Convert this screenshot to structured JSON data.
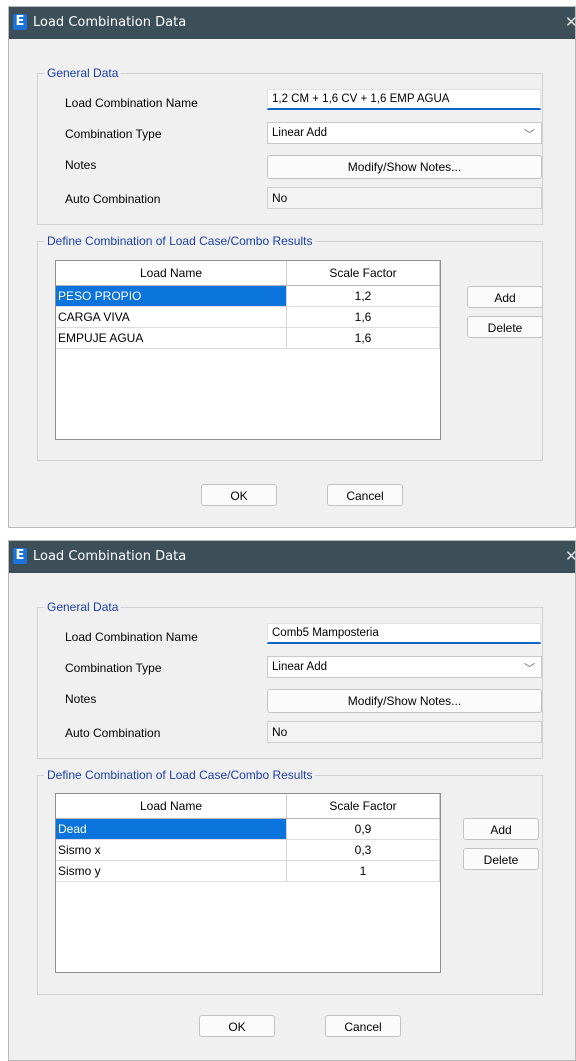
{
  "dialogs": [
    {
      "title": "Load Combination Data",
      "logo": "E",
      "general_group": "General Data",
      "name_label": "Load Combination Name",
      "name_value": "1,2 CM + 1,6 CV + 1,6 EMP AGUA",
      "type_label": "Combination Type",
      "type_value": "Linear Add",
      "notes_label": "Notes",
      "notes_button": "Modify/Show Notes...",
      "auto_label": "Auto Combination",
      "auto_value": "No",
      "define_group": "Define Combination of Load Case/Combo Results",
      "columns": [
        "Load Name",
        "Scale Factor"
      ],
      "rows": [
        {
          "name": "PESO PROPIO",
          "factor": "1,2",
          "selected": true
        },
        {
          "name": "CARGA VIVA",
          "factor": "1,6",
          "selected": false
        },
        {
          "name": "EMPUJE AGUA",
          "factor": "1,6",
          "selected": false
        }
      ],
      "add_button": "Add",
      "delete_button": "Delete",
      "ok_button": "OK",
      "cancel_button": "Cancel"
    },
    {
      "title": "Load Combination Data",
      "logo": "E",
      "general_group": "General Data",
      "name_label": "Load Combination Name",
      "name_value": "Comb5 Mamposteria",
      "type_label": "Combination Type",
      "type_value": "Linear Add",
      "notes_label": "Notes",
      "notes_button": "Modify/Show Notes...",
      "auto_label": "Auto Combination",
      "auto_value": "No",
      "define_group": "Define Combination of Load Case/Combo Results",
      "columns": [
        "Load Name",
        "Scale Factor"
      ],
      "rows": [
        {
          "name": "Dead",
          "factor": "0,9",
          "selected": true
        },
        {
          "name": "Sismo x",
          "factor": "0,3",
          "selected": false
        },
        {
          "name": "Sismo y",
          "factor": "1",
          "selected": false
        }
      ],
      "add_button": "Add",
      "delete_button": "Delete",
      "ok_button": "OK",
      "cancel_button": "Cancel"
    }
  ],
  "icons": {
    "close": "close-icon",
    "dropdown": "chevron-down-icon",
    "app": "etabs-logo-icon"
  },
  "colors": {
    "titlebar": "#3c4e58",
    "selection": "#0a73dc",
    "group_legend": "#1a3fa8",
    "input_underline": "#1064c8"
  }
}
